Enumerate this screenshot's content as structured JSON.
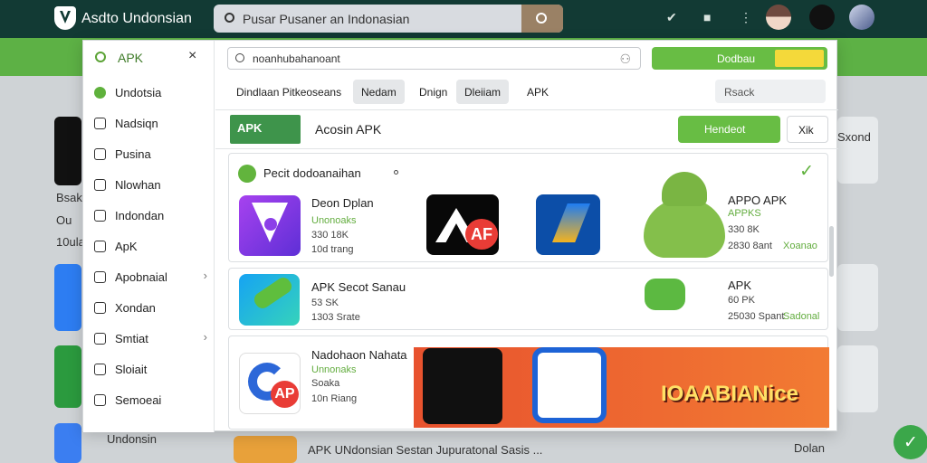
{
  "topbar": {
    "brand": "Asdto Undonsian",
    "search_text": "Pusar Pusaner an Indonasian",
    "icon_names": [
      "bookmark-icon",
      "folder-icon",
      "more-icon"
    ]
  },
  "background": {
    "left_labels": [
      "Bsak",
      "Ou",
      "10ulan"
    ],
    "right_labels": [
      "Sxond"
    ],
    "bottom_text": "Undonsin",
    "bottom_main": "APK UNdonsian Sestan  Jupuratonal Sasis ...",
    "bottom_right": "Dolan"
  },
  "dialog": {
    "search_label": "APK",
    "sidebar": [
      {
        "label": "Undotsia",
        "icon": "settings-icon",
        "chev": false
      },
      {
        "label": "Nadsiqn",
        "icon": "document-icon",
        "chev": false
      },
      {
        "label": "Pusina",
        "icon": "list-icon",
        "chev": false
      },
      {
        "label": "Nlowhan",
        "icon": "checkbox-icon",
        "chev": false
      },
      {
        "label": "Indondan",
        "icon": "bookmark-icon",
        "chev": false
      },
      {
        "label": "ApK",
        "icon": "apk-icon",
        "chev": false
      },
      {
        "label": "Apobnaial",
        "icon": "android-icon",
        "chev": true
      },
      {
        "label": "Xondan",
        "icon": "grid-icon",
        "chev": false
      },
      {
        "label": "Smtiat",
        "icon": "chat-icon",
        "chev": true
      },
      {
        "label": "Sloiait",
        "icon": "user-icon",
        "chev": false
      },
      {
        "label": "Semoeai",
        "icon": "folder-icon",
        "chev": false
      }
    ],
    "input_placeholder": "noanhubahanoant",
    "top_button": "Dodbau",
    "tabs": [
      "Dindlaan  Pitkeoseans",
      "Nedam",
      "Dnign",
      "Dleiiam",
      "APK"
    ],
    "tabs_active": [
      false,
      true,
      false,
      true,
      false
    ],
    "tab_search_placeholder": "Rsack",
    "apk_bar": {
      "title": "Acosin APK",
      "main_button": "Hendeot",
      "secondary_button": "Xik"
    },
    "section": {
      "title": "Pecit dodoanaihan"
    },
    "row1": {
      "item1": {
        "title": "Deon Dplan",
        "sub": "Unonoaks",
        "line1": "330 18K",
        "line2": "10d trang"
      },
      "item2": {
        "title": "APPO APK",
        "sub": "APPKS",
        "line1": "330 8K",
        "line2": "2830 8ant",
        "right": "Xoanao"
      }
    },
    "row2": {
      "item1": {
        "title": "APK Secot Sanau",
        "line1": "53 SK",
        "line2": "1303 Srate"
      },
      "item2": {
        "title": "APK",
        "line1": "60 PK",
        "line2": "25030 Spant",
        "right": "Sadonal"
      }
    },
    "row3": {
      "item1": {
        "title": "Nadohaon Nahata",
        "sub": "Unnonaks",
        "line1": "Soaka",
        "line2": "10n Riang"
      },
      "banner_text": "IOAABIANice"
    }
  },
  "colors": {
    "accent": "#68bd44",
    "dark": "#123a34",
    "orange": "#e8522e",
    "red": "#e73838",
    "purple": "#7b37e4"
  }
}
